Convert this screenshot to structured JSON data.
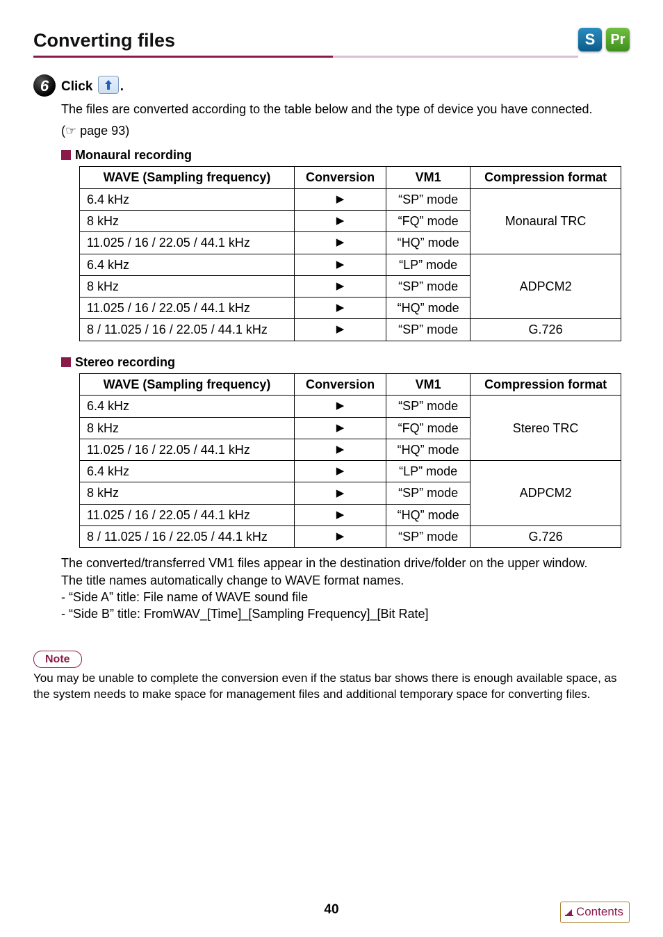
{
  "header": {
    "title": "Converting files",
    "badge_s": "S",
    "badge_pr": "Pr"
  },
  "step": {
    "number": "6",
    "prefix": "Click ",
    "suffix": "."
  },
  "intro": {
    "line1": "The files are converted according to the table below and the type of device you have connected.",
    "ref_prefix": "(",
    "ref_page": " page 93)",
    "pointer_glyph": "☞"
  },
  "mono": {
    "heading": "Monaural recording",
    "cols": {
      "c1": "WAVE (Sampling frequency)",
      "c2": "Conversion",
      "c3": "VM1",
      "c4": "Compression format"
    },
    "rows": [
      {
        "freq": "6.4 kHz",
        "vm1": "“SP” mode"
      },
      {
        "freq": "8 kHz",
        "vm1": "“FQ” mode"
      },
      {
        "freq": "11.025 / 16 / 22.05 / 44.1 kHz",
        "vm1": "“HQ” mode"
      },
      {
        "freq": "6.4 kHz",
        "vm1": "“LP” mode"
      },
      {
        "freq": "8 kHz",
        "vm1": "“SP” mode"
      },
      {
        "freq": "11.025 / 16 / 22.05 / 44.1 kHz",
        "vm1": "“HQ” mode"
      },
      {
        "freq": "8 / 11.025 / 16 / 22.05 / 44.1 kHz",
        "vm1": "“SP” mode"
      }
    ],
    "formats": {
      "g1": "Monaural TRC",
      "g2": "ADPCM2",
      "g3": "G.726"
    },
    "arrow": "▶"
  },
  "stereo": {
    "heading": "Stereo recording",
    "cols": {
      "c1": "WAVE (Sampling frequency)",
      "c2": "Conversion",
      "c3": "VM1",
      "c4": "Compression format"
    },
    "rows": [
      {
        "freq": "6.4 kHz",
        "vm1": "“SP” mode"
      },
      {
        "freq": "8 kHz",
        "vm1": "“FQ” mode"
      },
      {
        "freq": "11.025 / 16 / 22.05 / 44.1 kHz",
        "vm1": "“HQ” mode"
      },
      {
        "freq": "6.4 kHz",
        "vm1": "“LP” mode"
      },
      {
        "freq": "8 kHz",
        "vm1": "“SP” mode"
      },
      {
        "freq": "11.025 / 16 / 22.05 / 44.1 kHz",
        "vm1": "“HQ” mode"
      },
      {
        "freq": "8 / 11.025 / 16 / 22.05 / 44.1 kHz",
        "vm1": "“SP” mode"
      }
    ],
    "formats": {
      "g1": "Stereo TRC",
      "g2": "ADPCM2",
      "g3": "G.726"
    },
    "arrow": "▶"
  },
  "post": {
    "p1": "The converted/transferred VM1 files appear in the destination drive/folder on the upper window.",
    "p2": "The title names automatically change to WAVE format names.",
    "b1": "- “Side A” title: File name of WAVE sound file",
    "b2": "- “Side B” title: FromWAV_[Time]_[Sampling Frequency]_[Bit Rate]"
  },
  "note": {
    "label": "Note",
    "text": "You may be unable to complete the conversion even if the status bar shows there is enough available space, as the system needs to make space for management files and additional temporary space for converting files."
  },
  "footer": {
    "page": "40",
    "contents": "Contents"
  }
}
